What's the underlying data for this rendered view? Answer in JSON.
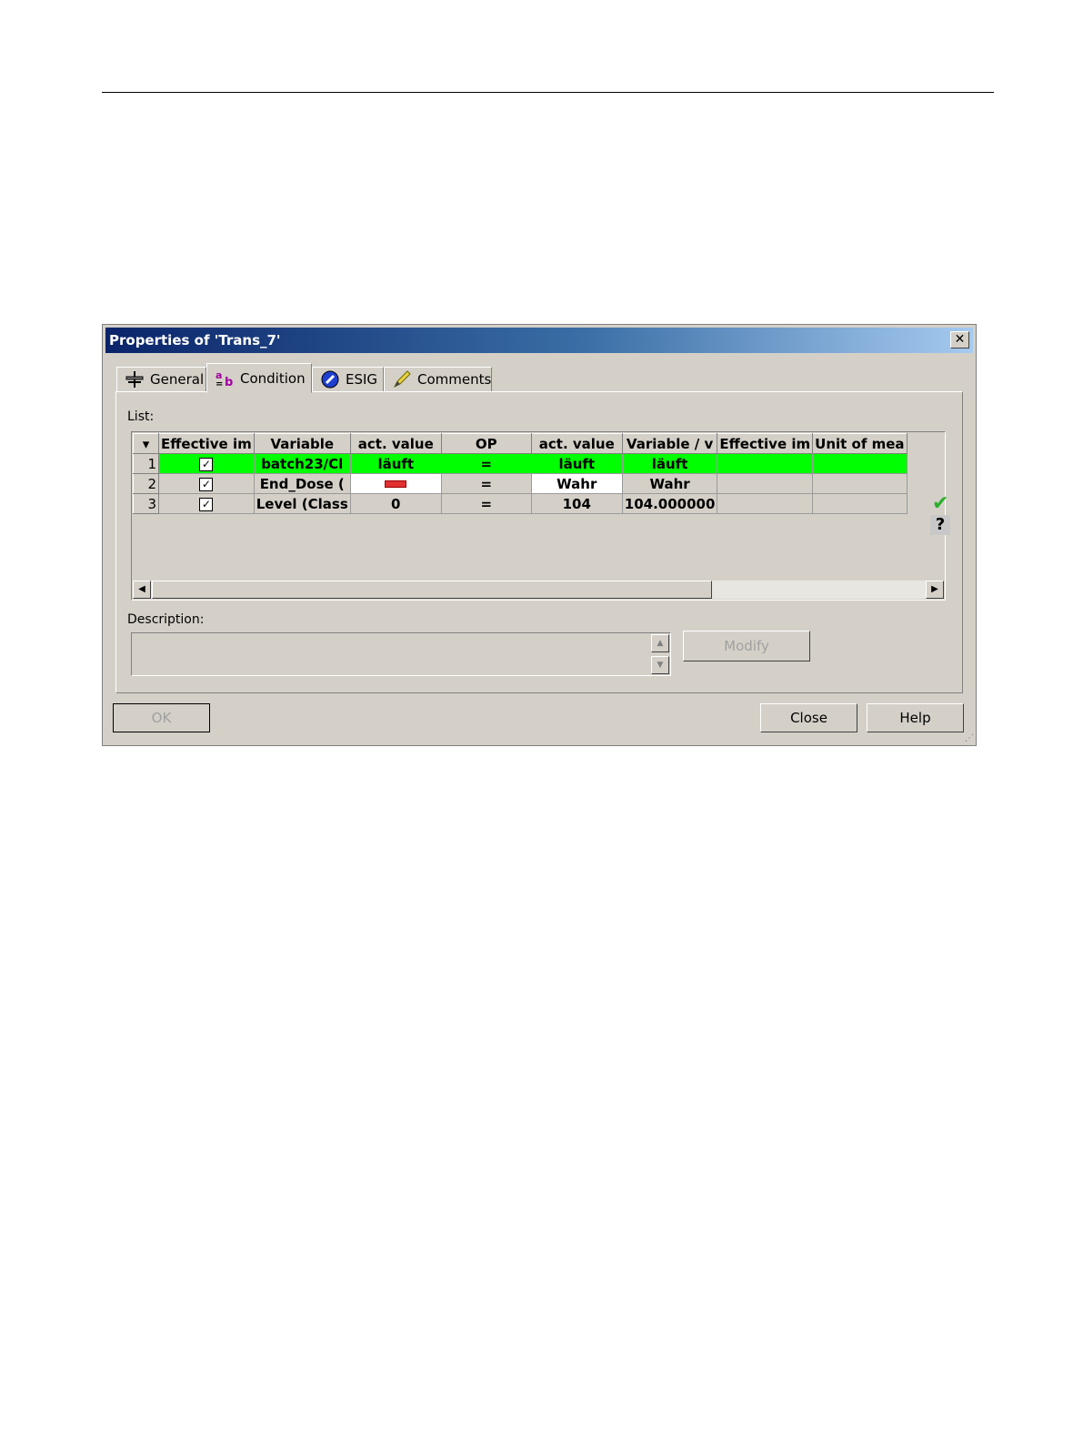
{
  "dialog": {
    "title": "Properties of 'Trans_7'",
    "close_glyph": "✕"
  },
  "tabs": [
    {
      "label": "General",
      "icon": "general-icon"
    },
    {
      "label": "Condition",
      "icon": "condition-icon",
      "active": true
    },
    {
      "label": "ESIG",
      "icon": "esig-icon"
    },
    {
      "label": "Comments",
      "icon": "pencil-icon"
    }
  ],
  "list": {
    "label": "List:",
    "sort_glyph": "▾",
    "columns": [
      "Effective im",
      "Variable",
      "act. value",
      "OP",
      "act. value",
      "Variable / v",
      "Effective im",
      "Unit of mea"
    ],
    "rows": [
      {
        "num": "1",
        "checked": "✓",
        "variable": "batch23/Cl",
        "act1": "läuft",
        "op": "=",
        "act2": "läuft",
        "var2": "läuft",
        "eff2": "",
        "unit": ""
      },
      {
        "num": "2",
        "checked": "✓",
        "variable": "End_Dose (",
        "act1": "",
        "op": "=",
        "act2": "Wahr",
        "var2": "Wahr",
        "eff2": "",
        "unit": ""
      },
      {
        "num": "3",
        "checked": "✓",
        "variable": "Level (Class",
        "act1": "0",
        "op": "=",
        "act2": "104",
        "var2": "104.000000",
        "eff2": "",
        "unit": ""
      }
    ],
    "status_check": "✔",
    "status_question": "?",
    "scroll_left": "◀",
    "scroll_right": "▶"
  },
  "description": {
    "label": "Description:",
    "value": "",
    "up": "▲",
    "down": "▼"
  },
  "buttons": {
    "modify": "Modify",
    "ok": "OK",
    "close": "Close",
    "help": "Help"
  },
  "colors": {
    "row_true": "#00ff00",
    "dialog_bg": "#d4d0c8",
    "titlebar_start": "#0a246a",
    "titlebar_end": "#a6caf0"
  }
}
